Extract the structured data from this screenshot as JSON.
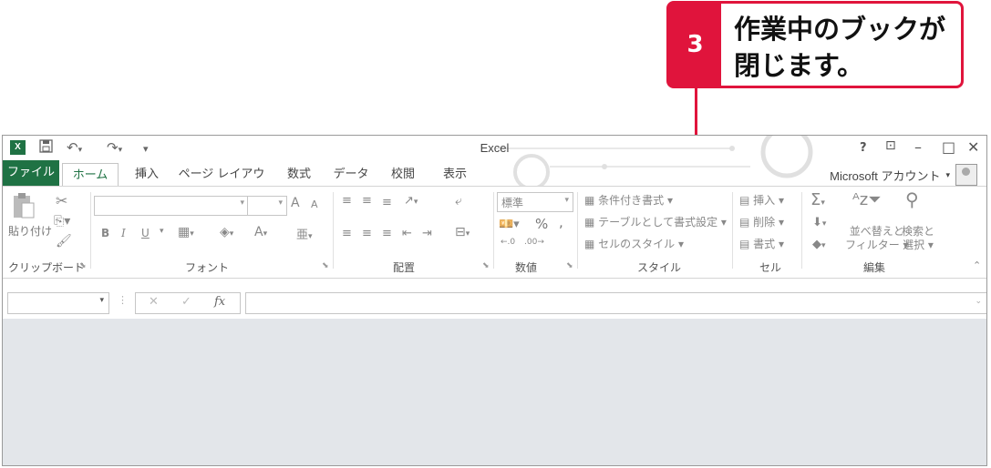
{
  "callout": {
    "number": "3",
    "line1": "作業中のブックが",
    "line2": "閉じます。"
  },
  "window": {
    "title": "Excel",
    "app_icon": "X",
    "quick_access": [
      "save-icon",
      "undo-icon",
      "redo-icon",
      "customize-icon"
    ],
    "controls": {
      "help": "?",
      "ribbon_display": "⊡",
      "minimize": "–",
      "restore": "□",
      "close": "✕"
    }
  },
  "tabs": [
    "ファイル",
    "ホーム",
    "挿入",
    "ページ レイアウト",
    "数式",
    "データ",
    "校閲",
    "表示"
  ],
  "active_tab": "ホーム",
  "account": {
    "label": "Microsoft アカウント"
  },
  "ribbon": {
    "clipboard": {
      "paste": "貼り付け",
      "label": "クリップボード"
    },
    "font": {
      "label": "フォント",
      "bold": "B",
      "italic": "I",
      "underline": "U",
      "grow": "A",
      "shrink": "A"
    },
    "alignment": {
      "label": "配置"
    },
    "number": {
      "label": "数値",
      "format": "標準",
      "percent": "%",
      "comma": ","
    },
    "styles": {
      "label": "スタイル",
      "conditional": "条件付き書式",
      "table": "テーブルとして書式設定",
      "cell_styles": "セルのスタイル"
    },
    "cells": {
      "label": "セル",
      "insert": "挿入",
      "delete": "削除",
      "format": "書式"
    },
    "editing": {
      "label": "編集",
      "sort": "並べ替えと",
      "sort2": "フィルター",
      "find": "検索と",
      "find2": "選択"
    }
  },
  "formula_bar": {
    "name_box": "",
    "fx": "fx",
    "cancel": "✕",
    "enter": "✓",
    "value": ""
  },
  "colors": {
    "accent": "#e0143c",
    "excel_green": "#1f7244",
    "workspace": "#e3e6ea"
  }
}
